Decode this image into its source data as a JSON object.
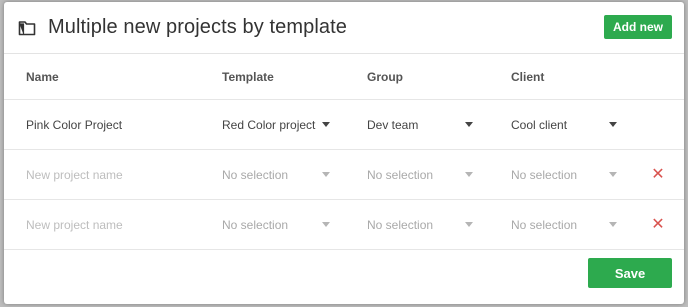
{
  "header": {
    "icon": "folder-icon",
    "title": "Multiple new projects by template",
    "add_new_label": "Add new"
  },
  "columns": {
    "name": "Name",
    "template": "Template",
    "group": "Group",
    "client": "Client"
  },
  "rows": [
    {
      "name": "Pink Color Project",
      "template": "Red Color project",
      "group": "Dev team",
      "client": "Cool client"
    },
    {
      "name": "",
      "name_placeholder": "New project name",
      "template": "No selection",
      "group": "No selection",
      "client": "No selection",
      "delete_icon": "close-icon"
    },
    {
      "name": "",
      "name_placeholder": "New project name",
      "template": "No selection",
      "group": "No selection",
      "client": "No selection",
      "delete_icon": "close-icon"
    }
  ],
  "footer": {
    "save_label": "Save"
  },
  "colors": {
    "accent": "#2daa4e",
    "delete": "#d9534f",
    "placeholder": "#a9a9a9"
  }
}
